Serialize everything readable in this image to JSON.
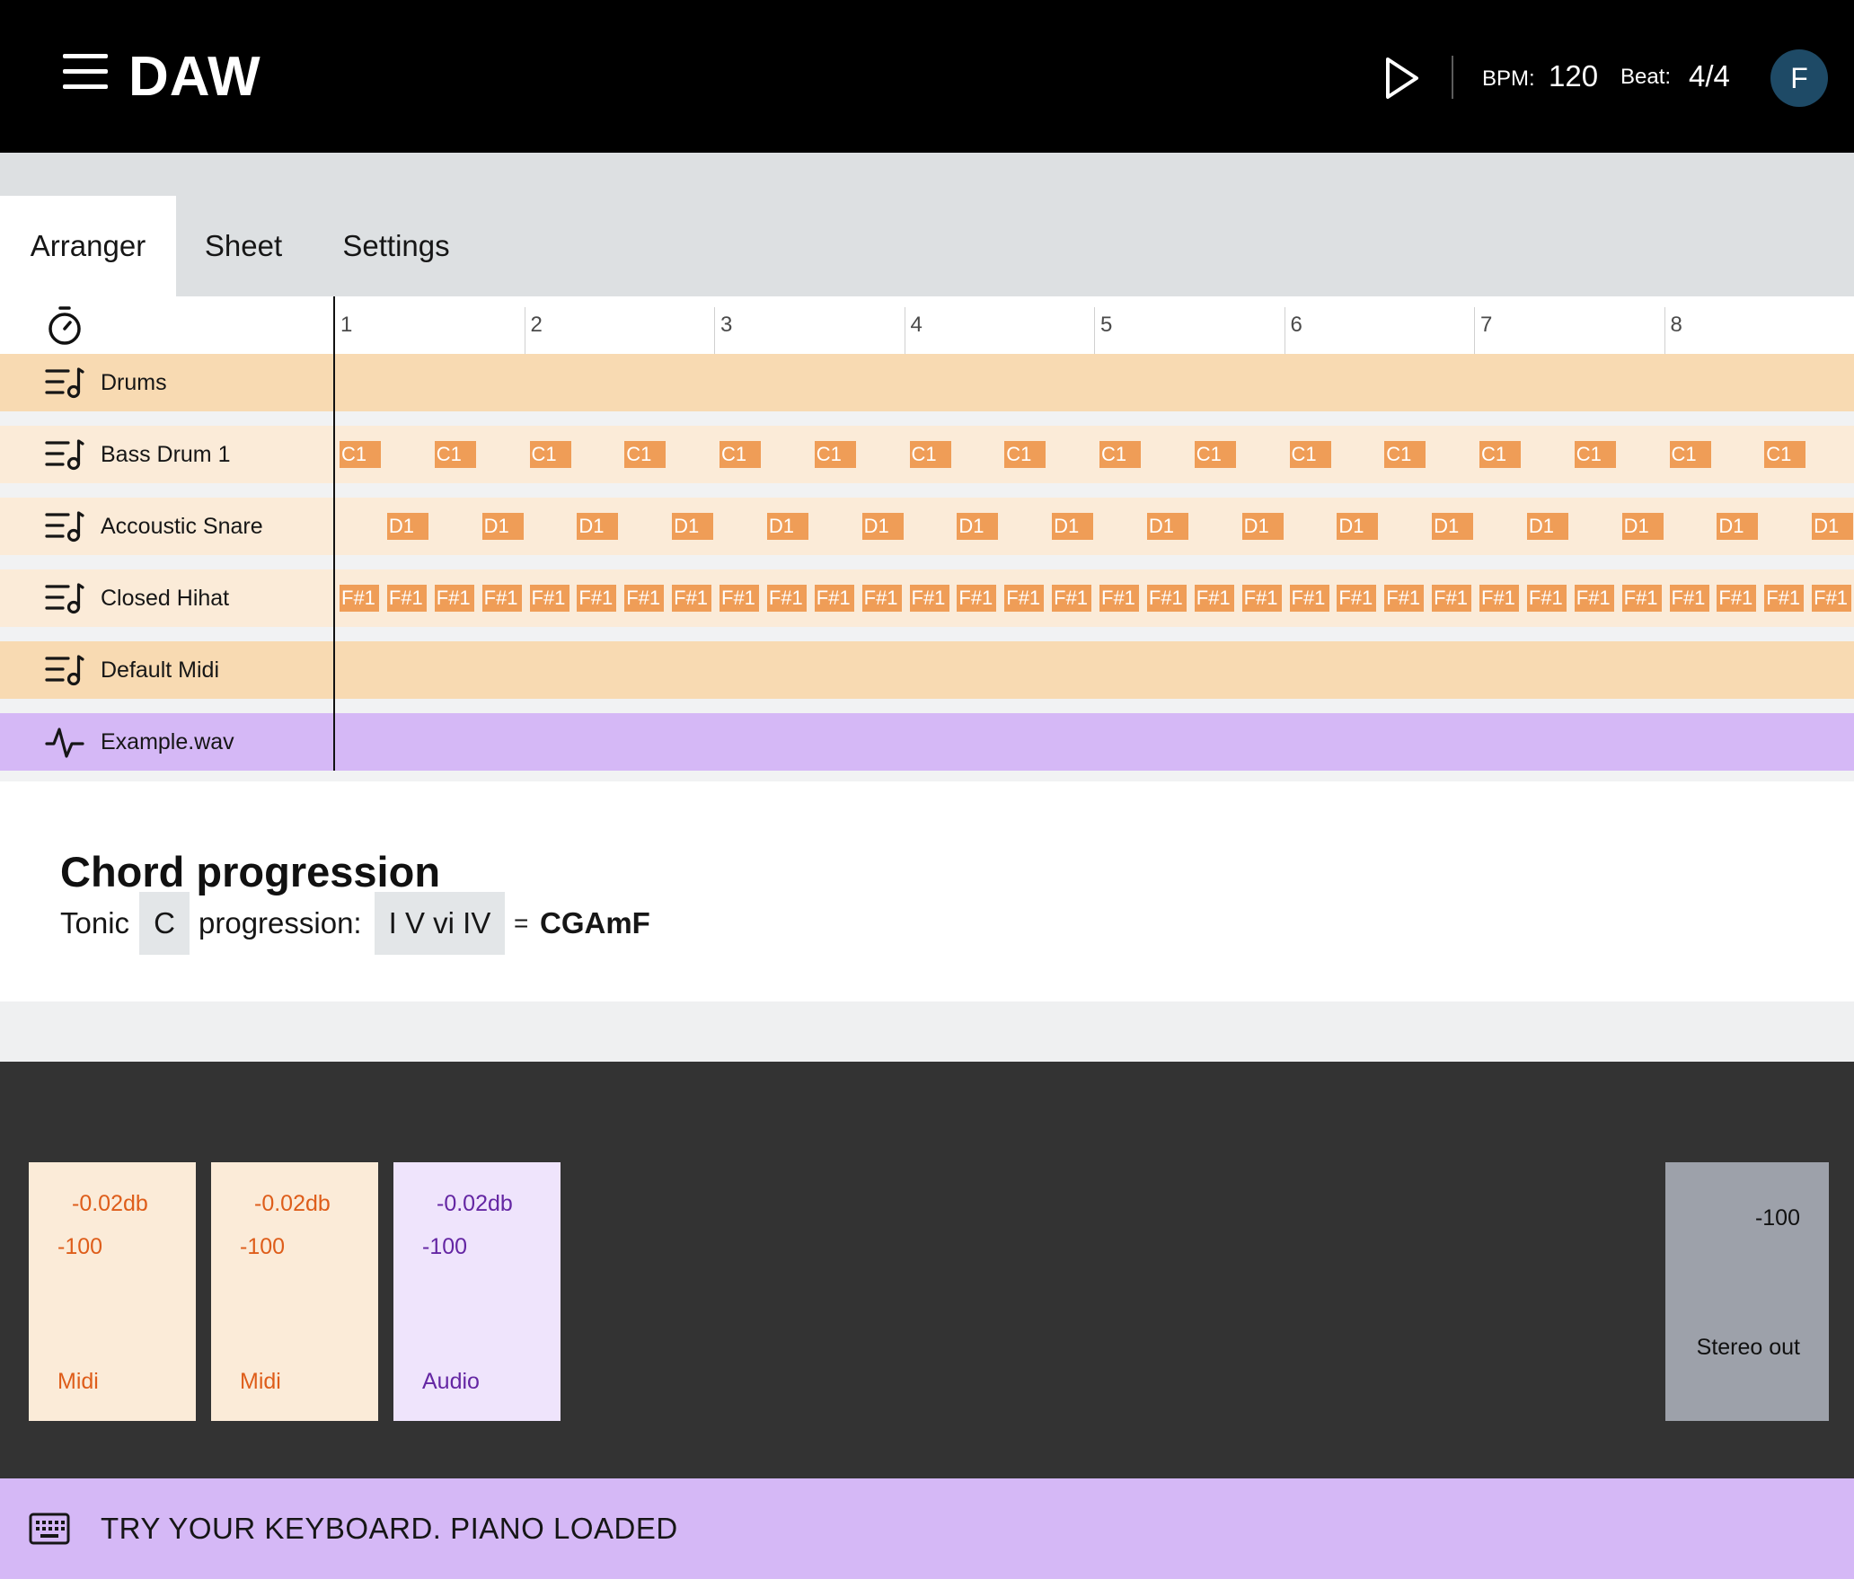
{
  "header": {
    "app_title": "DAW",
    "bpm_label": "BPM:",
    "bpm_value": "120",
    "beat_label": "Beat:",
    "beat_value": "4/4",
    "avatar_initial": "F"
  },
  "tabs": [
    {
      "label": "Arranger",
      "active": true
    },
    {
      "label": "Sheet",
      "active": false
    },
    {
      "label": "Settings",
      "active": false
    }
  ],
  "ruler": {
    "bars": [
      "1",
      "2",
      "3",
      "4",
      "5",
      "6",
      "7",
      "8"
    ]
  },
  "tracks": [
    {
      "name": "Drums",
      "kind": "group",
      "icon": "midi-track-icon",
      "notes": []
    },
    {
      "name": "Bass Drum 1",
      "kind": "instrument",
      "icon": "midi-track-icon",
      "note_label": "C1",
      "note_count": 16,
      "note_start_step": 0
    },
    {
      "name": "Accoustic Snare",
      "kind": "instrument",
      "icon": "midi-track-icon",
      "note_label": "D1",
      "note_count": 16,
      "note_start_step": 1
    },
    {
      "name": "Closed Hihat",
      "kind": "instrument",
      "icon": "midi-track-icon",
      "note_label": "F#1",
      "note_count": 32,
      "note_start_step": 0
    },
    {
      "name": "Default Midi",
      "kind": "group",
      "icon": "midi-track-icon",
      "notes": []
    },
    {
      "name": "Example.wav",
      "kind": "audio",
      "icon": "waveform-icon",
      "notes": []
    }
  ],
  "chord_progression": {
    "title": "Chord progression",
    "tonic_label": "Tonic",
    "tonic_value": "C",
    "progression_label": "progression:",
    "progression_value": "I V vi IV",
    "equals": "=",
    "result": "CGAmF"
  },
  "mixer": {
    "channels": [
      {
        "db": "-0.02db",
        "volume": "-100",
        "type": "Midi"
      },
      {
        "db": "-0.02db",
        "volume": "-100",
        "type": "Midi"
      },
      {
        "db": "-0.02db",
        "volume": "-100",
        "type": "Audio"
      }
    ],
    "stereo_out": {
      "volume": "-100",
      "label": "Stereo out"
    }
  },
  "status_bar": {
    "icon": "keyboard-icon",
    "text": "TRY YOUR KEYBOARD. PIANO LOADED"
  },
  "colors": {
    "header_bg": "#000000",
    "midi_group": "#f8dab2",
    "midi_track": "#fbebd8",
    "note": "#ef9d57",
    "audio": "#d5b8f6",
    "mixer_bg": "#333333",
    "avatar": "#1e4a66"
  }
}
